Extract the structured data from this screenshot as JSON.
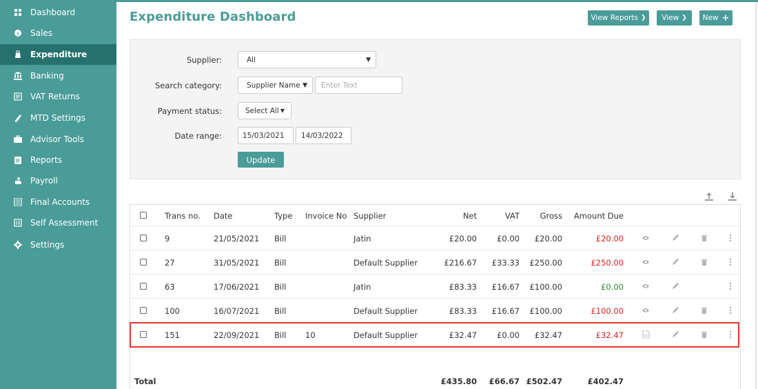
{
  "sidebar": {
    "items": [
      {
        "label": "Dashboard",
        "icon": "grid-icon"
      },
      {
        "label": "Sales",
        "icon": "sales-icon"
      },
      {
        "label": "Expenditure",
        "icon": "expenditure-icon",
        "active": true
      },
      {
        "label": "Banking",
        "icon": "bank-icon"
      },
      {
        "label": "VAT Returns",
        "icon": "vat-icon"
      },
      {
        "label": "MTD Settings",
        "icon": "mtd-icon"
      },
      {
        "label": "Advisor Tools",
        "icon": "briefcase-icon"
      },
      {
        "label": "Reports",
        "icon": "reports-icon"
      },
      {
        "label": "Payroll",
        "icon": "payroll-icon"
      },
      {
        "label": "Final Accounts",
        "icon": "final-accounts-icon"
      },
      {
        "label": "Self Assessment",
        "icon": "self-assessment-icon"
      },
      {
        "label": "Settings",
        "icon": "gear-icon"
      }
    ]
  },
  "header": {
    "title": "Expenditure Dashboard",
    "view_reports_label": "View Reports",
    "view_label": "View",
    "new_label": "New"
  },
  "filters": {
    "supplier_label": "Supplier:",
    "supplier_value": "All",
    "search_category_label": "Search category:",
    "search_category_value": "Supplier Name",
    "search_text_placeholder": "Enter Text",
    "payment_status_label": "Payment status:",
    "payment_status_value": "Select All",
    "date_range_label": "Date range:",
    "date_from": "15/03/2021",
    "date_to": "14/03/2022",
    "update_label": "Update"
  },
  "table": {
    "headers": {
      "trans_no": "Trans no.",
      "date": "Date",
      "type": "Type",
      "invoice_no": "Invoice No",
      "supplier": "Supplier",
      "net": "Net",
      "vat": "VAT",
      "gross": "Gross",
      "amount_due": "Amount Due"
    },
    "rows": [
      {
        "trans_no": "9",
        "date": "21/05/2021",
        "type": "Bill",
        "invoice_no": "",
        "supplier": "Jatin",
        "net": "£20.00",
        "vat": "£0.00",
        "gross": "£20.00",
        "amount_due": "£20.00",
        "due_status": "red",
        "has_delete": true,
        "view_icon": "eye-icon"
      },
      {
        "trans_no": "27",
        "date": "31/05/2021",
        "type": "Bill",
        "invoice_no": "",
        "supplier": "Default Supplier",
        "net": "£216.67",
        "vat": "£33.33",
        "gross": "£250.00",
        "amount_due": "£250.00",
        "due_status": "red",
        "has_delete": true,
        "view_icon": "eye-icon"
      },
      {
        "trans_no": "63",
        "date": "17/06/2021",
        "type": "Bill",
        "invoice_no": "",
        "supplier": "Jatin",
        "net": "£83.33",
        "vat": "£16.67",
        "gross": "£100.00",
        "amount_due": "£0.00",
        "due_status": "green",
        "has_delete": false,
        "view_icon": "eye-icon"
      },
      {
        "trans_no": "100",
        "date": "16/07/2021",
        "type": "Bill",
        "invoice_no": "",
        "supplier": "Default Supplier",
        "net": "£83.33",
        "vat": "£16.67",
        "gross": "£100.00",
        "amount_due": "£100.00",
        "due_status": "red",
        "has_delete": true,
        "view_icon": "eye-icon"
      },
      {
        "trans_no": "151",
        "date": "22/09/2021",
        "type": "Bill",
        "invoice_no": "10",
        "supplier": "Default Supplier",
        "net": "£32.47",
        "vat": "£0.00",
        "gross": "£32.47",
        "amount_due": "£32.47",
        "due_status": "red",
        "has_delete": true,
        "view_icon": "pdf-icon",
        "highlighted": true
      }
    ],
    "total": {
      "label": "Total",
      "net": "£435.80",
      "vat": "£66.67",
      "gross": "£502.47",
      "amount_due": "£402.47"
    }
  },
  "colors": {
    "brand": "#4a9c98",
    "sidebar_active": "#26716d",
    "due_red": "#e02020",
    "paid_green": "#2a8a2a",
    "highlight": "#e03a2a"
  }
}
